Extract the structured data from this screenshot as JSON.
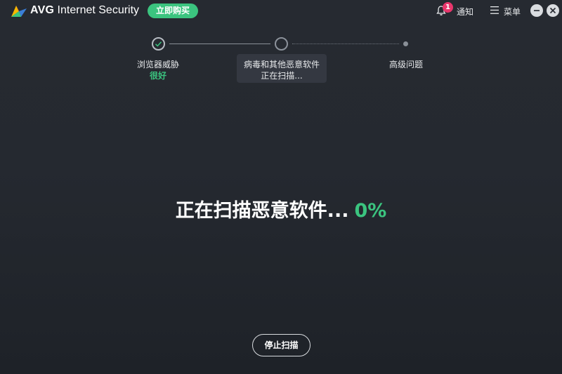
{
  "app": {
    "brand": "AVG",
    "product": "Internet Security",
    "buy_label": "立即购买"
  },
  "header": {
    "notify_label": "通知",
    "notify_count": "1",
    "menu_label": "菜单"
  },
  "steps": [
    {
      "label": "浏览器威胁",
      "status": "很好"
    },
    {
      "label": "病毒和其他恶意软件",
      "status": "正在扫描..."
    },
    {
      "label": "高级问题",
      "status": ""
    }
  ],
  "scan": {
    "text": "正在扫描恶意软件...",
    "percent": "0%"
  },
  "stop_label": "停止扫描",
  "colors": {
    "accent": "#3bc47f",
    "badge": "#e8366c",
    "background": "#252930"
  }
}
